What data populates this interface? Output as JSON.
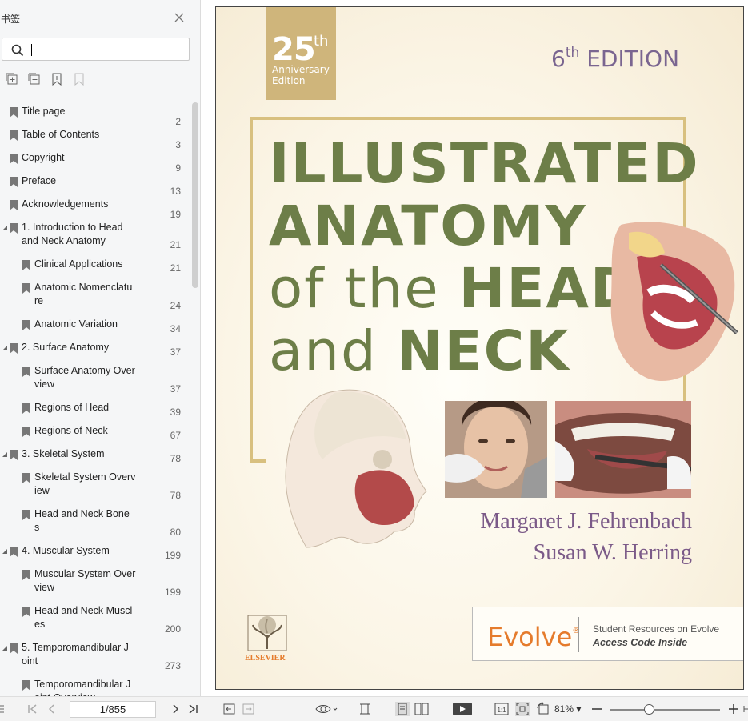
{
  "sidebar": {
    "title": "书签",
    "search": {
      "value": "",
      "placeholder": ""
    },
    "items": [
      {
        "label": "Title page",
        "page": "2",
        "level": 0,
        "expandable": false
      },
      {
        "label": "Table of Contents",
        "page": "3",
        "level": 0,
        "expandable": false
      },
      {
        "label": "Copyright",
        "page": "9",
        "level": 0,
        "expandable": false
      },
      {
        "label": "Preface",
        "page": "13",
        "level": 0,
        "expandable": false
      },
      {
        "label": "Acknowledgements",
        "page": "19",
        "level": 0,
        "expandable": false
      },
      {
        "label": "1. Introduction to Head\nand Neck Anatomy",
        "page": "21",
        "level": 0,
        "expandable": true
      },
      {
        "label": "Clinical Applications",
        "page": "21",
        "level": 1,
        "expandable": false
      },
      {
        "label": "Anatomic Nomenclatu\nre",
        "page": "24",
        "level": 1,
        "expandable": false
      },
      {
        "label": "Anatomic Variation",
        "page": "34",
        "level": 1,
        "expandable": false
      },
      {
        "label": "2. Surface Anatomy",
        "page": "37",
        "level": 0,
        "expandable": true
      },
      {
        "label": "Surface Anatomy Over\nview",
        "page": "37",
        "level": 1,
        "expandable": false
      },
      {
        "label": "Regions of Head",
        "page": "39",
        "level": 1,
        "expandable": false
      },
      {
        "label": "Regions of Neck",
        "page": "67",
        "level": 1,
        "expandable": false
      },
      {
        "label": "3. Skeletal System",
        "page": "78",
        "level": 0,
        "expandable": true
      },
      {
        "label": "Skeletal System Overv\niew",
        "page": "78",
        "level": 1,
        "expandable": false
      },
      {
        "label": "Head and Neck Bone\ns",
        "page": "80",
        "level": 1,
        "expandable": false
      },
      {
        "label": "4. Muscular System",
        "page": "199",
        "level": 0,
        "expandable": true
      },
      {
        "label": "Muscular System Over\nview",
        "page": "199",
        "level": 1,
        "expandable": false
      },
      {
        "label": "Head and Neck Muscl\nes",
        "page": "200",
        "level": 1,
        "expandable": false
      },
      {
        "label": "5. Temporomandibular J\noint",
        "page": "273",
        "level": 0,
        "expandable": true
      },
      {
        "label": "Temporomandibular J\noint Overview",
        "page": "",
        "level": 1,
        "expandable": false
      }
    ]
  },
  "cover": {
    "badge_number": "25",
    "badge_suffix": "th",
    "badge_line1": "Anniversary",
    "badge_line2": "Edition",
    "edition_number": "6",
    "edition_suffix": "th",
    "edition_word": "EDITION",
    "title_line1": "ILLUSTRATED",
    "title_line2": "ANATOMY",
    "title_line3_a": "of the ",
    "title_line3_b": "HEAD",
    "title_line4_a": "and ",
    "title_line4_b": "NECK",
    "author1": "Margaret J. Fehrenbach",
    "author2": "Susan W. Herring",
    "evolve_brand": "Evolve",
    "evolve_mark": "®",
    "evolve_line1": "Student Resources on Evolve",
    "evolve_line2": "Access Code Inside",
    "publisher": "ELSEVIER"
  },
  "statusbar": {
    "page_indicator": "1/855",
    "zoom_level": "81%",
    "zoom_fraction": 0.36
  },
  "colors": {
    "title_green": "#6d7e48",
    "gold": "#d8c07f",
    "purple": "#7a6590",
    "evolve_orange": "#e57b2c"
  }
}
